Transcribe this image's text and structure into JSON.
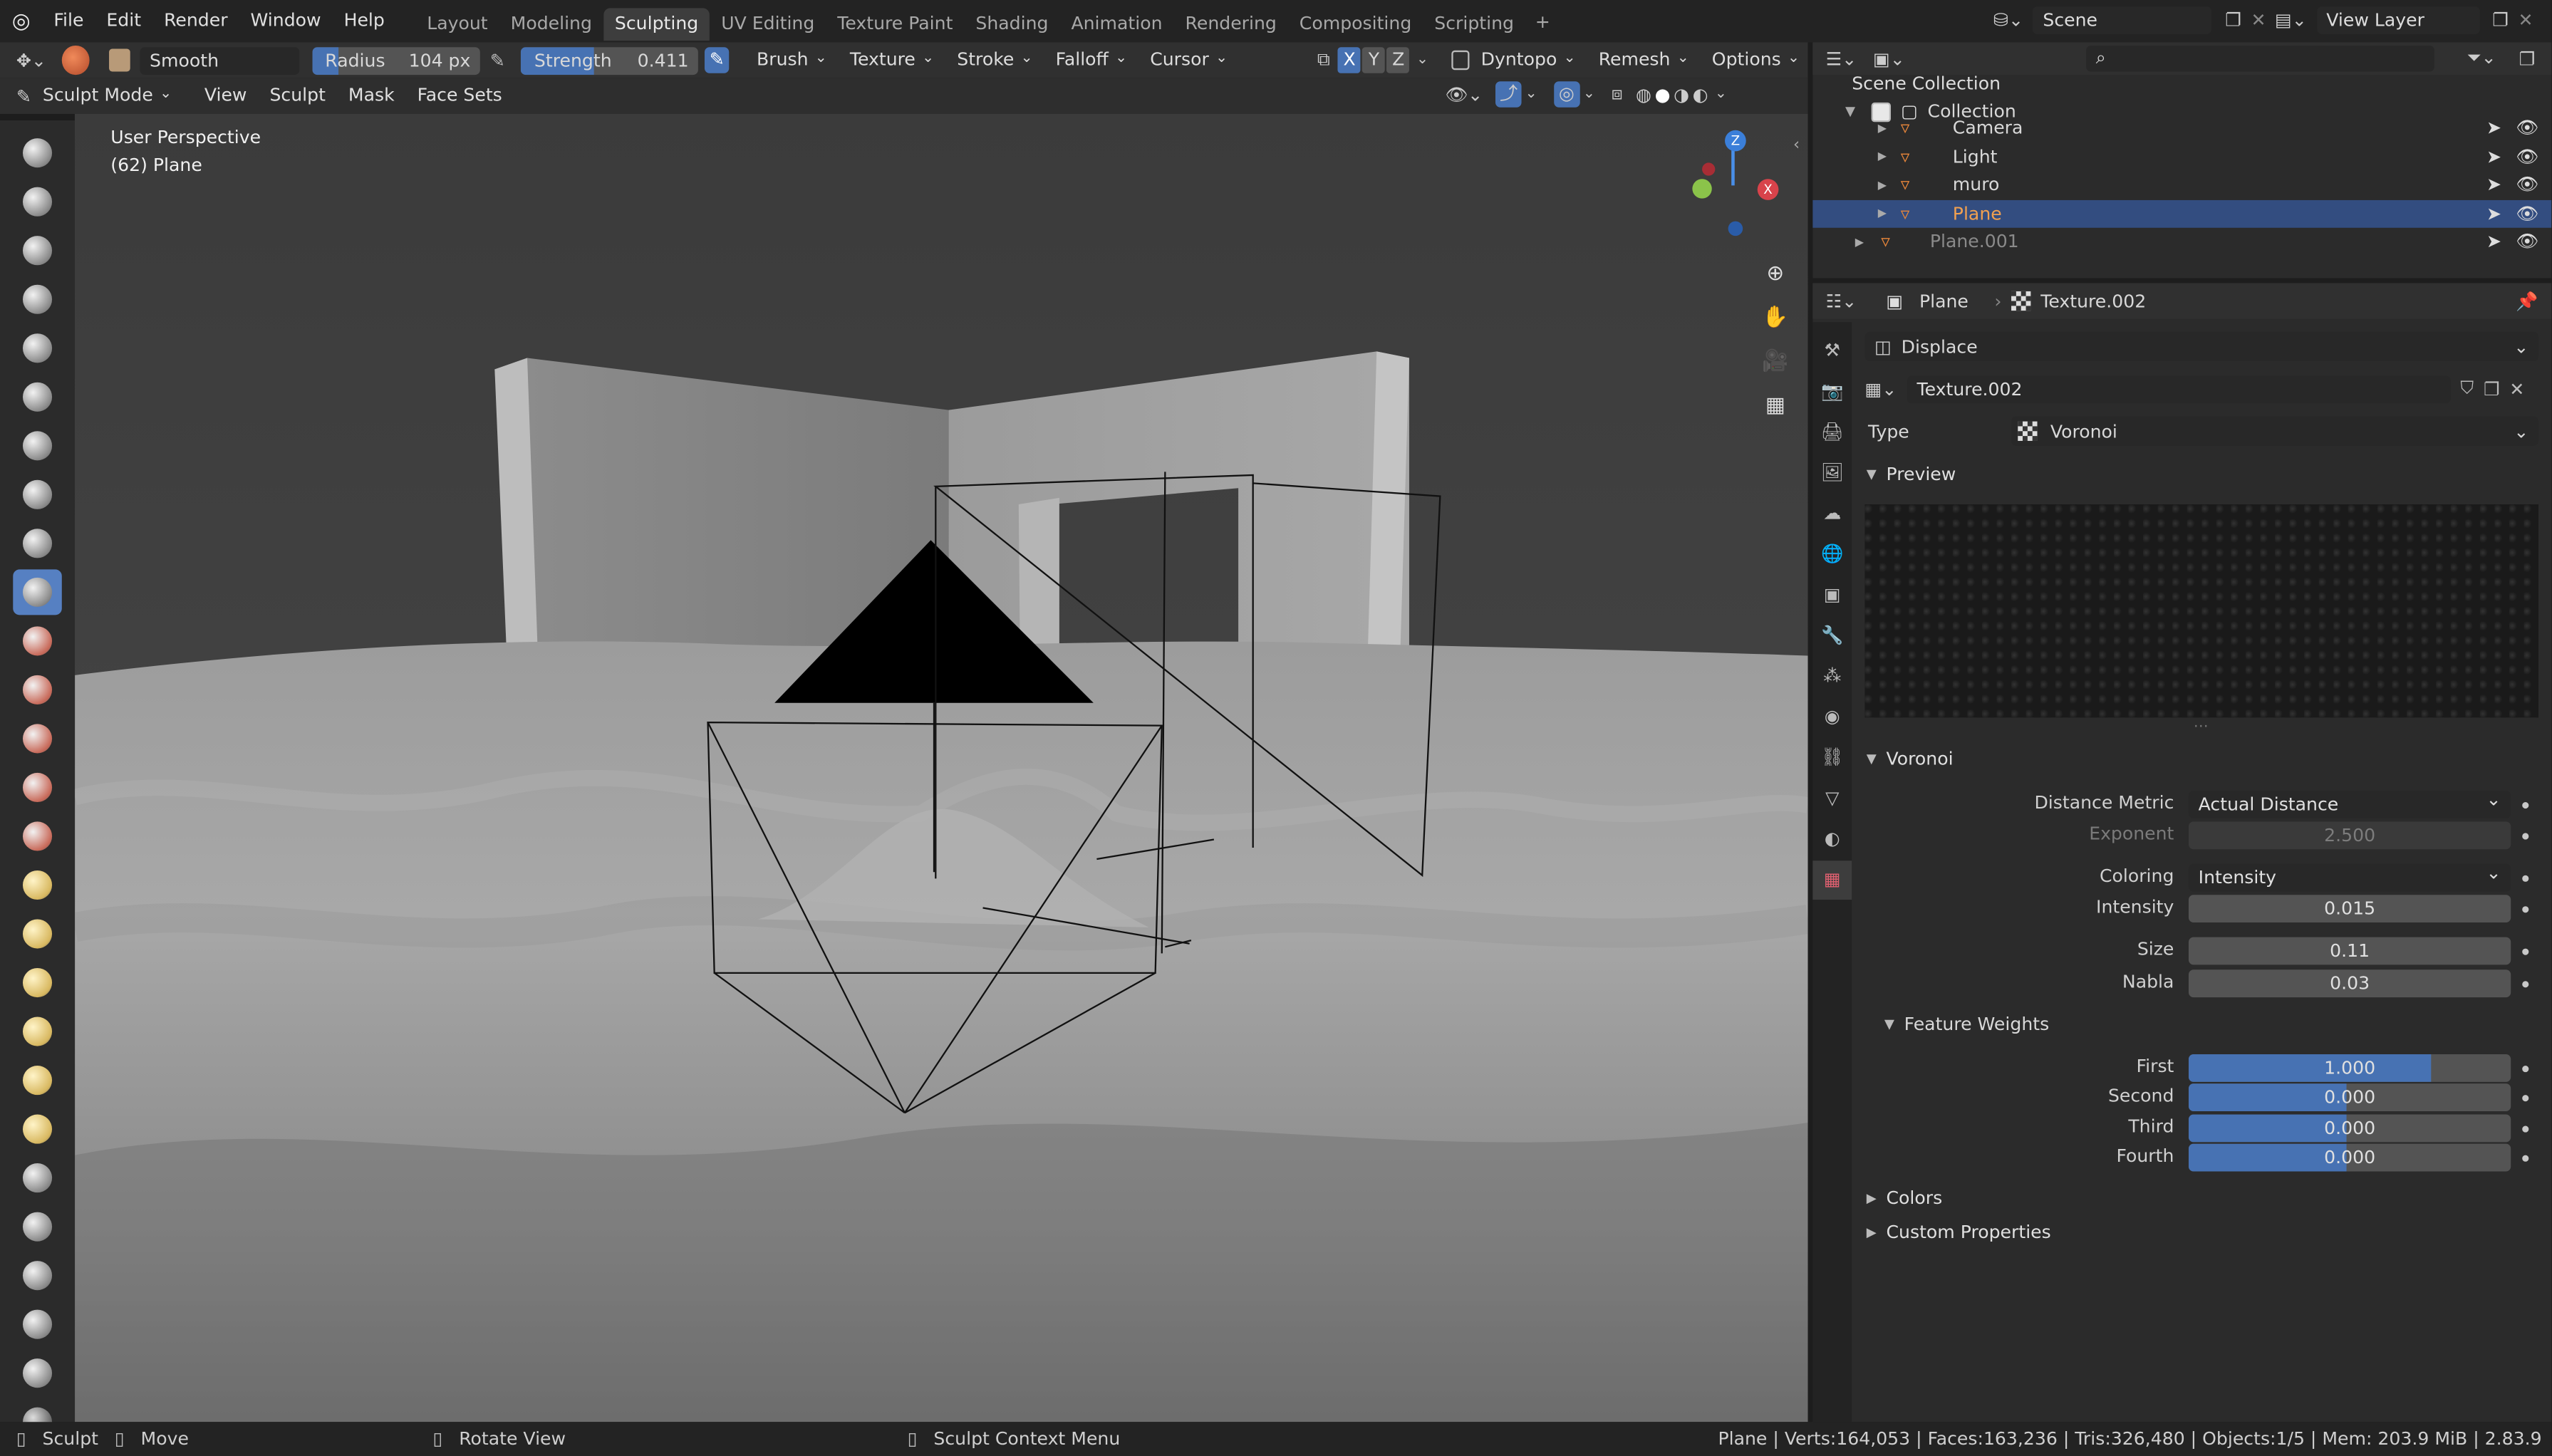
{
  "menus": [
    "File",
    "Edit",
    "Render",
    "Window",
    "Help"
  ],
  "workspaces": [
    "Layout",
    "Modeling",
    "Sculpting",
    "UV Editing",
    "Texture Paint",
    "Shading",
    "Animation",
    "Rendering",
    "Compositing",
    "Scripting"
  ],
  "active_workspace": "Sculpting",
  "scene": {
    "name": "Scene",
    "view_layer": "View Layer"
  },
  "tool_header": {
    "brush_name": "Smooth",
    "radius_label": "Radius",
    "radius_value": "104 px",
    "strength_label": "Strength",
    "strength_value": "0.411",
    "strength_fraction": 0.411,
    "dropdowns": [
      "Brush",
      "Texture",
      "Stroke",
      "Falloff",
      "Cursor"
    ],
    "axes": [
      "X",
      "Y",
      "Z"
    ],
    "dyntopo": "Dyntopo",
    "remesh": "Remesh",
    "options": "Options"
  },
  "mode_header": {
    "mode": "Sculpt Mode",
    "menus": [
      "View",
      "Sculpt",
      "Mask",
      "Face Sets"
    ]
  },
  "viewport": {
    "perspective": "User Perspective",
    "object": "(62) Plane"
  },
  "outliner": {
    "root": "Scene Collection",
    "collection": "Collection",
    "items": [
      {
        "name": "Camera"
      },
      {
        "name": "Light"
      },
      {
        "name": "muro"
      },
      {
        "name": "Plane",
        "selected": true
      },
      {
        "name": "Plane.001",
        "dim": true
      }
    ]
  },
  "properties": {
    "object": "Plane",
    "texture": "Texture.002",
    "mapping": "Displace",
    "texture_name": "Texture.002",
    "type_label": "Type",
    "type_value": "Voronoi",
    "preview_label": "Preview",
    "voronoi_label": "Voronoi",
    "fields": [
      {
        "label": "Distance Metric",
        "value": "Actual Distance"
      },
      {
        "label": "Exponent",
        "value": "2.500"
      },
      {
        "label": "Coloring",
        "value": "Intensity"
      },
      {
        "label": "Intensity",
        "value": "0.015"
      },
      {
        "label": "Size",
        "value": "0.11"
      },
      {
        "label": "Nabla",
        "value": "0.03"
      }
    ],
    "feature_weights_label": "Feature Weights",
    "weights": [
      {
        "label": "First",
        "value": "1.000",
        "fraction": 1.0
      },
      {
        "label": "Second",
        "value": "0.000",
        "fraction": 0.0
      },
      {
        "label": "Third",
        "value": "0.000",
        "fraction": 0.0
      },
      {
        "label": "Fourth",
        "value": "0.000",
        "fraction": 0.0
      }
    ],
    "colors_label": "Colors",
    "custom_label": "Custom Properties"
  },
  "status": {
    "left": "Sculpt",
    "move": "Move",
    "rotate": "Rotate View",
    "context": "Sculpt Context Menu",
    "stats": "Plane | Verts:164,053 | Faces:163,236 | Tris:326,480 | Objects:1/5 | Mem: 203.9 MiB | 2.83.9"
  },
  "colors": {
    "accent": "#4772b3",
    "selected_row": "#334d80",
    "orange": "#e8863a"
  }
}
